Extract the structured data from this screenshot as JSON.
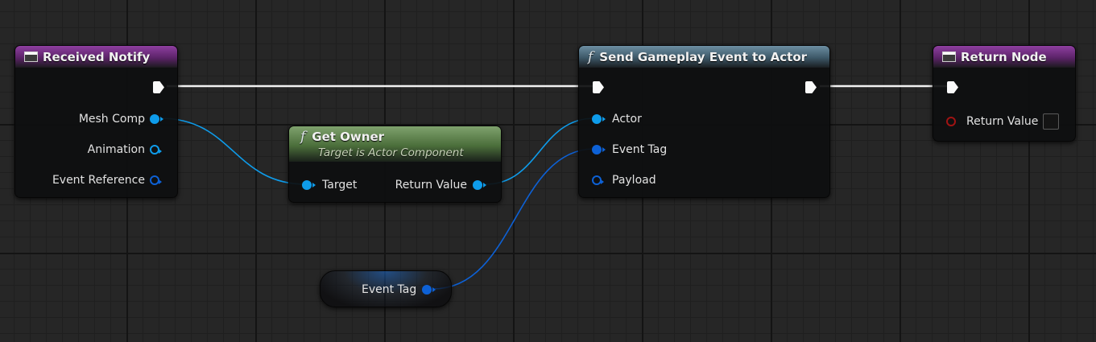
{
  "nodes": {
    "received_notify": {
      "title": "Received Notify",
      "pins": [
        "Mesh Comp",
        "Animation",
        "Event Reference"
      ]
    },
    "get_owner": {
      "title": "Get Owner",
      "subtitle": "Target is Actor Component",
      "input": "Target",
      "output": "Return Value"
    },
    "send_event": {
      "title": "Send Gameplay Event to Actor",
      "pins": [
        "Actor",
        "Event Tag",
        "Payload"
      ]
    },
    "return_node": {
      "title": "Return Node",
      "pin": "Return Value"
    },
    "event_tag_getter": {
      "label": "Event Tag"
    }
  },
  "icons": {
    "event": "event-node-icon",
    "function": "function-icon"
  },
  "colors": {
    "event_header": "#8e3fa0",
    "function_header": "#6c8ea2",
    "pure_header": "#7fa26d",
    "object_pin": "#0e9ceb",
    "struct_pin": "#0d61d6",
    "bool_pin": "#a01313",
    "exec": "#fafafa"
  }
}
